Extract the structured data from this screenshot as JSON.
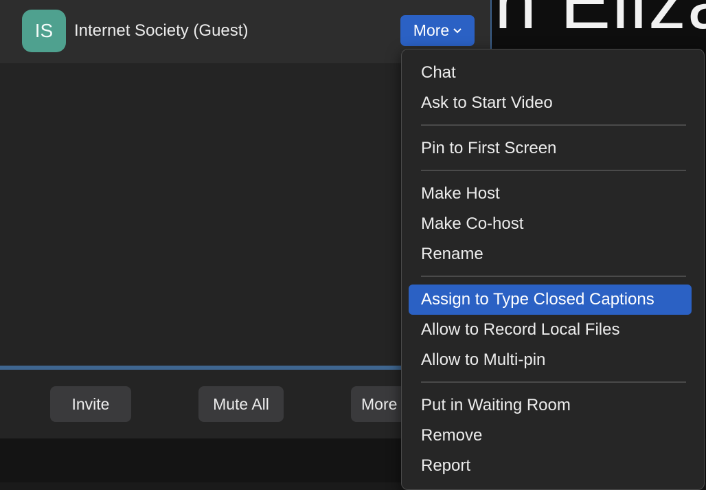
{
  "background": {
    "video_text": "n Eliza"
  },
  "participant": {
    "initials": "IS",
    "name": "Internet Society (Guest)",
    "more_label": "More",
    "avatar_color": "#4fa18f"
  },
  "footer": {
    "invite_label": "Invite",
    "mute_all_label": "Mute All",
    "more_label": "More"
  },
  "menu": {
    "items": [
      "Chat",
      "Ask to Start Video",
      "Pin to First Screen",
      "Make Host",
      "Make Co-host",
      "Rename",
      "Assign to Type Closed Captions",
      "Allow to Record Local Files",
      "Allow to Multi-pin",
      "Put in Waiting Room",
      "Remove",
      "Report"
    ],
    "selected": "Assign to Type Closed Captions"
  },
  "colors": {
    "accent": "#2b61c4",
    "panel_bg": "#242424",
    "menu_bg": "#262626"
  }
}
